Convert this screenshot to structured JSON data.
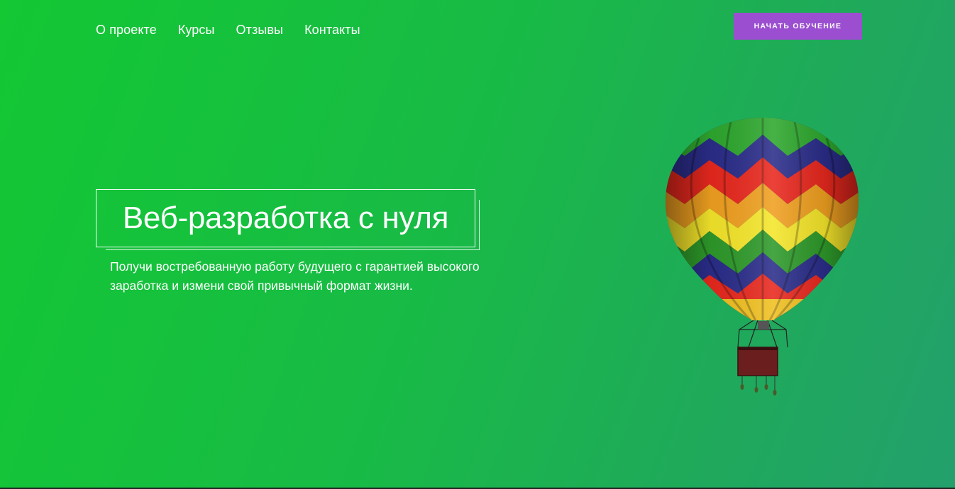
{
  "nav": {
    "items": [
      {
        "label": "О проекте"
      },
      {
        "label": "Курсы"
      },
      {
        "label": "Отзывы"
      },
      {
        "label": "Контакты"
      }
    ]
  },
  "header": {
    "cta_label": "Начать обучение"
  },
  "hero": {
    "title": "Веб-разработка с нуля",
    "subtitle": "Получи востребованную работу будущего с гарантией высокого заработка и измени свой привычный формат жизни."
  },
  "colors": {
    "background_start": "#13c833",
    "background_end": "#23a06c",
    "cta_background": "#9b4fd0",
    "text": "#ffffff"
  },
  "icons": {
    "hero_image": "hot-air-balloon-icon"
  }
}
